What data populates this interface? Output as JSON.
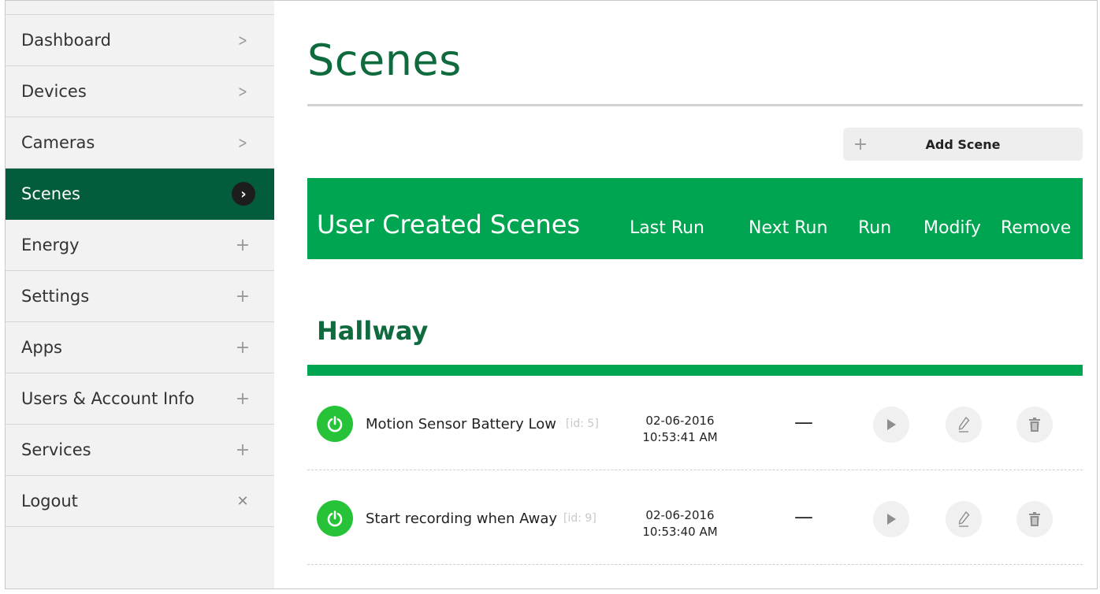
{
  "sidebar": {
    "items": [
      {
        "label": "Dashboard",
        "indicator": "chevron",
        "glyph": ">"
      },
      {
        "label": "Devices",
        "indicator": "chevron",
        "glyph": ">"
      },
      {
        "label": "Cameras",
        "indicator": "chevron",
        "glyph": ">"
      },
      {
        "label": "Scenes",
        "indicator": "active-chevron",
        "glyph": "›",
        "active": true
      },
      {
        "label": "Energy",
        "indicator": "plus",
        "glyph": "+"
      },
      {
        "label": "Settings",
        "indicator": "plus",
        "glyph": "+"
      },
      {
        "label": "Apps",
        "indicator": "plus",
        "glyph": "+"
      },
      {
        "label": "Users & Account Info",
        "indicator": "plus",
        "glyph": "+"
      },
      {
        "label": "Services",
        "indicator": "plus",
        "glyph": "+"
      },
      {
        "label": "Logout",
        "indicator": "close",
        "glyph": "✕"
      }
    ]
  },
  "main": {
    "title": "Scenes",
    "add_scene": {
      "icon": "plus-icon",
      "label": "Add Scene",
      "glyph": "+"
    },
    "table_header": {
      "title": "User Created Scenes",
      "columns": [
        "Last Run",
        "Next Run",
        "Run",
        "Modify",
        "Remove"
      ]
    },
    "group": {
      "name": "Hallway",
      "scenes": [
        {
          "name": "Motion Sensor Battery Low",
          "id": "[id: 5]",
          "last_run_date": "02-06-2016",
          "last_run_time": "10:53:41 AM",
          "next_run": "—"
        },
        {
          "name": "Start recording when Away",
          "id": "[id: 9]",
          "last_run_date": "02-06-2016",
          "last_run_time": "10:53:40 AM",
          "next_run": "—"
        }
      ]
    }
  },
  "colors": {
    "brand_green": "#00a551",
    "dark_green": "#035c3b",
    "title_green": "#0f6b3e",
    "power_green": "#26c339"
  }
}
